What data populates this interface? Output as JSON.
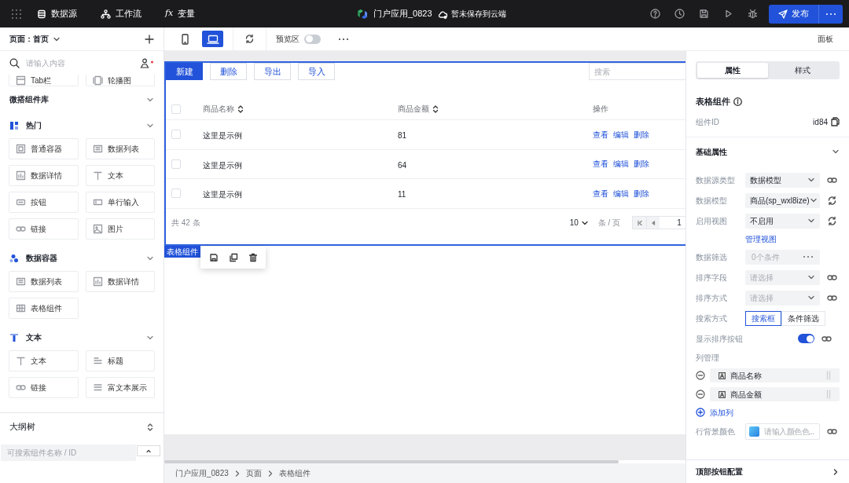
{
  "top_bar": {
    "nav": [
      {
        "kind": "datasource",
        "label": "数据源"
      },
      {
        "kind": "workflow",
        "label": "工作流"
      },
      {
        "kind": "variable",
        "icon_text": "fx",
        "label": "变量"
      }
    ],
    "app_title": "门户应用_0823",
    "save_status": "暂未保存到云端",
    "publish_label": "发布"
  },
  "left_panel": {
    "page_selector": "页面：首页",
    "search_placeholder": "请输入内容",
    "clipped_items": [
      {
        "kind": "tabs",
        "label": "Tab栏"
      },
      {
        "kind": "carousel",
        "label": "轮播图"
      }
    ],
    "library_title": "微搭组件库",
    "library_expanded": true,
    "groups": [
      {
        "kind": "popular",
        "title": "热门",
        "expanded": true,
        "items": [
          {
            "kind": "container",
            "label": "普通容器"
          },
          {
            "kind": "list",
            "label": "数据列表"
          },
          {
            "kind": "detail",
            "label": "数据详情"
          },
          {
            "kind": "text",
            "label": "文本"
          },
          {
            "kind": "button",
            "label": "按钮"
          },
          {
            "kind": "input",
            "label": "单行输入"
          },
          {
            "kind": "link",
            "label": "链接"
          },
          {
            "kind": "image",
            "label": "图片"
          }
        ]
      },
      {
        "kind": "data",
        "title": "数据容器",
        "expanded": true,
        "items": [
          {
            "kind": "list",
            "label": "数据列表"
          },
          {
            "kind": "detail",
            "label": "数据详情"
          },
          {
            "kind": "table",
            "label": "表格组件"
          }
        ]
      },
      {
        "kind": "text",
        "title": "文本",
        "expanded": true,
        "items": [
          {
            "kind": "text",
            "label": "文本"
          },
          {
            "kind": "heading",
            "label": "标题"
          },
          {
            "kind": "link",
            "label": "链接"
          },
          {
            "kind": "richtext",
            "label": "富文本展示"
          }
        ]
      }
    ],
    "outline": {
      "title": "大纲树",
      "search_placeholder": "可搜索组件名称 / ID"
    }
  },
  "canvas": {
    "devices": [
      {
        "kind": "mobile",
        "selected": false
      },
      {
        "kind": "desktop",
        "selected": true
      }
    ],
    "preview": {
      "label": "预览区",
      "on": false
    },
    "panel_label": "面板",
    "table": {
      "buttons": [
        {
          "kind": "primary",
          "label": "新建"
        },
        {
          "kind": "default",
          "label": "删除"
        },
        {
          "kind": "default",
          "label": "导出"
        },
        {
          "kind": "default",
          "label": "导入"
        }
      ],
      "search_placeholder": "搜索",
      "all_selected": false,
      "columns": [
        {
          "label": "商品名称",
          "sortable": true
        },
        {
          "label": "商品金额",
          "sortable": true
        },
        {
          "label": "操作",
          "sortable": false
        }
      ],
      "rows": [
        {
          "checked": false,
          "name": "这里是示例",
          "amount": "81",
          "actions": [
            "查看",
            "编辑",
            "删除"
          ]
        },
        {
          "checked": false,
          "name": "这里是示例",
          "amount": "64",
          "actions": [
            "查看",
            "编辑",
            "删除"
          ]
        },
        {
          "checked": false,
          "name": "这里是示例",
          "amount": "11",
          "actions": [
            "查看",
            "编辑",
            "删除"
          ]
        }
      ],
      "total": "共 42 条",
      "page_size": "10",
      "per_page": "条 / 页",
      "page": "1"
    },
    "selection_tag": "表格组件",
    "breadcrumb": [
      "门户应用_0823",
      "页面",
      "表格组件"
    ]
  },
  "properties_panel": {
    "tabs": [
      {
        "label": "属性",
        "selected": true
      },
      {
        "label": "样式",
        "selected": false
      }
    ],
    "title": "表格组件",
    "id_label": "组件ID",
    "id_value": "id84",
    "section": {
      "title": "基础属性",
      "expanded": true
    },
    "fields": [
      {
        "kind": "select",
        "label": "数据源类型",
        "value": "数据模型",
        "bindable": true,
        "refreshable": false
      },
      {
        "kind": "select",
        "label": "数据模型",
        "value": "商品(sp_wxl8ize)",
        "bindable": false,
        "refreshable": true
      },
      {
        "kind": "select",
        "label": "启用视图",
        "value": "不启用",
        "bindable": false,
        "refreshable": true
      },
      {
        "kind": "action_link",
        "label": "管理视图"
      },
      {
        "kind": "filter",
        "label": "数据筛选",
        "placeholder": "0个条件"
      },
      {
        "kind": "select",
        "label": "排序字段",
        "placeholder": "请选择",
        "bindable": true,
        "refreshable": false
      },
      {
        "kind": "select",
        "label": "排序方式",
        "placeholder": "请选择",
        "bindable": true,
        "refreshable": false
      },
      {
        "kind": "segmented",
        "label": "搜索方式",
        "options": [
          {
            "label": "搜索框",
            "selected": true
          },
          {
            "label": "条件筛选",
            "selected": false
          }
        ]
      },
      {
        "kind": "toggle",
        "label": "显示排序按钮",
        "on": true,
        "bindable": true
      }
    ],
    "column_manager": {
      "title": "列管理",
      "columns": [
        {
          "label": "商品名称"
        },
        {
          "label": "商品金额"
        }
      ],
      "add_label": "添加列"
    },
    "row_background": {
      "label": "行背景颜色",
      "placeholder": "请输入颜色色...",
      "bindable": true
    },
    "footer_section": {
      "title": "顶部按钮配置"
    }
  }
}
